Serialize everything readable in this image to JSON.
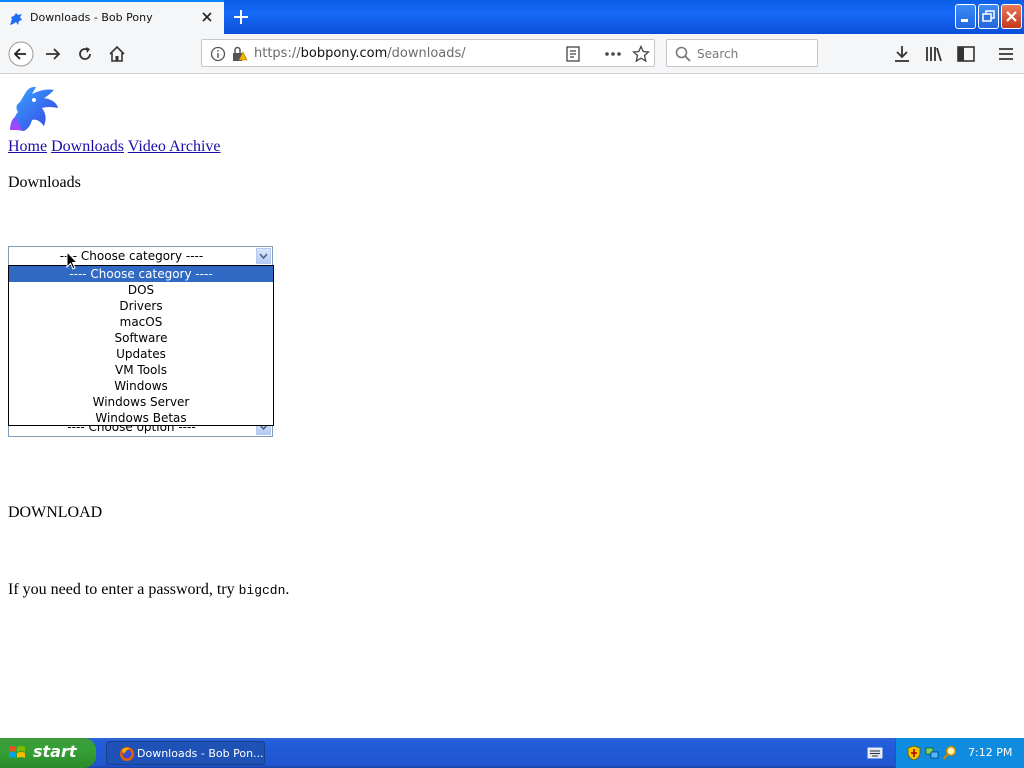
{
  "window": {
    "tab_title": "Downloads - Bob Pony"
  },
  "toolbar": {
    "url_scheme": "https://",
    "url_host": "bobpony.com",
    "url_path": "/downloads/",
    "search_placeholder": "Search"
  },
  "page": {
    "nav_links": [
      "Home",
      "Downloads",
      "Video Archive"
    ],
    "heading": "Downloads",
    "category_select": {
      "selected": "---- Choose category ----",
      "options": [
        "---- Choose category ----",
        "DOS",
        "Drivers",
        "macOS",
        "Software",
        "Updates",
        "VM Tools",
        "Windows",
        "Windows Server",
        "Windows Betas"
      ],
      "highlighted_index": 0
    },
    "option_select": {
      "selected": "---- Choose option ----"
    },
    "download_label": "DOWNLOAD",
    "password_text": "If you need to enter a password, try ",
    "password_value": "bigcdn",
    "password_suffix": "."
  },
  "taskbar": {
    "start_label": "start",
    "task_label": "Downloads - Bob Pon...",
    "clock": "7:12 PM"
  },
  "icons": {
    "favicon": "pony-icon",
    "logo": "pony-logo"
  },
  "colors": {
    "titlebar": "#0b57e0",
    "selection": "#316ac5",
    "link": "#1a0dab",
    "start_green": "#35a135",
    "taskbar": "#245edb"
  }
}
